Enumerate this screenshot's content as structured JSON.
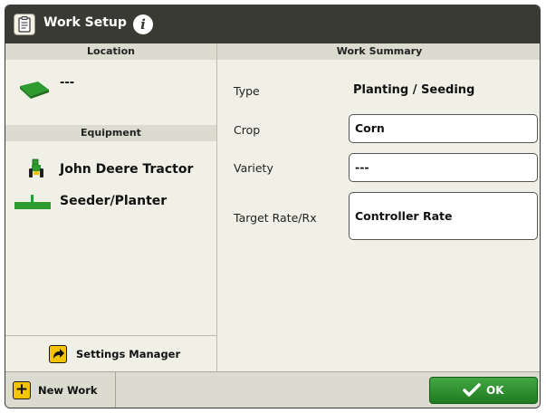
{
  "window": {
    "title": "Work Setup"
  },
  "location": {
    "header": "Location",
    "value": "---"
  },
  "equipment": {
    "header": "Equipment",
    "items": [
      {
        "label": "John Deere Tractor",
        "icon": "tractor-icon"
      },
      {
        "label": "Seeder/Planter",
        "icon": "planter-icon"
      }
    ]
  },
  "settings_manager": {
    "label": "Settings Manager",
    "icon": "arrow-icon"
  },
  "work_summary": {
    "header": "Work Summary",
    "type_label": "Type",
    "type_value": "Planting / Seeding",
    "crop_label": "Crop",
    "crop_value": "Corn",
    "variety_label": "Variety",
    "variety_value": "---",
    "rate_label": "Target Rate/Rx",
    "rate_value": "Controller Rate"
  },
  "footer": {
    "new_work_label": "New Work",
    "ok_label": "OK"
  },
  "colors": {
    "titlebar": "#3a3a34",
    "accent_green": "#2e8b2e",
    "button_yellow": "#f5c400",
    "panel_bg": "#f1f0e7"
  }
}
